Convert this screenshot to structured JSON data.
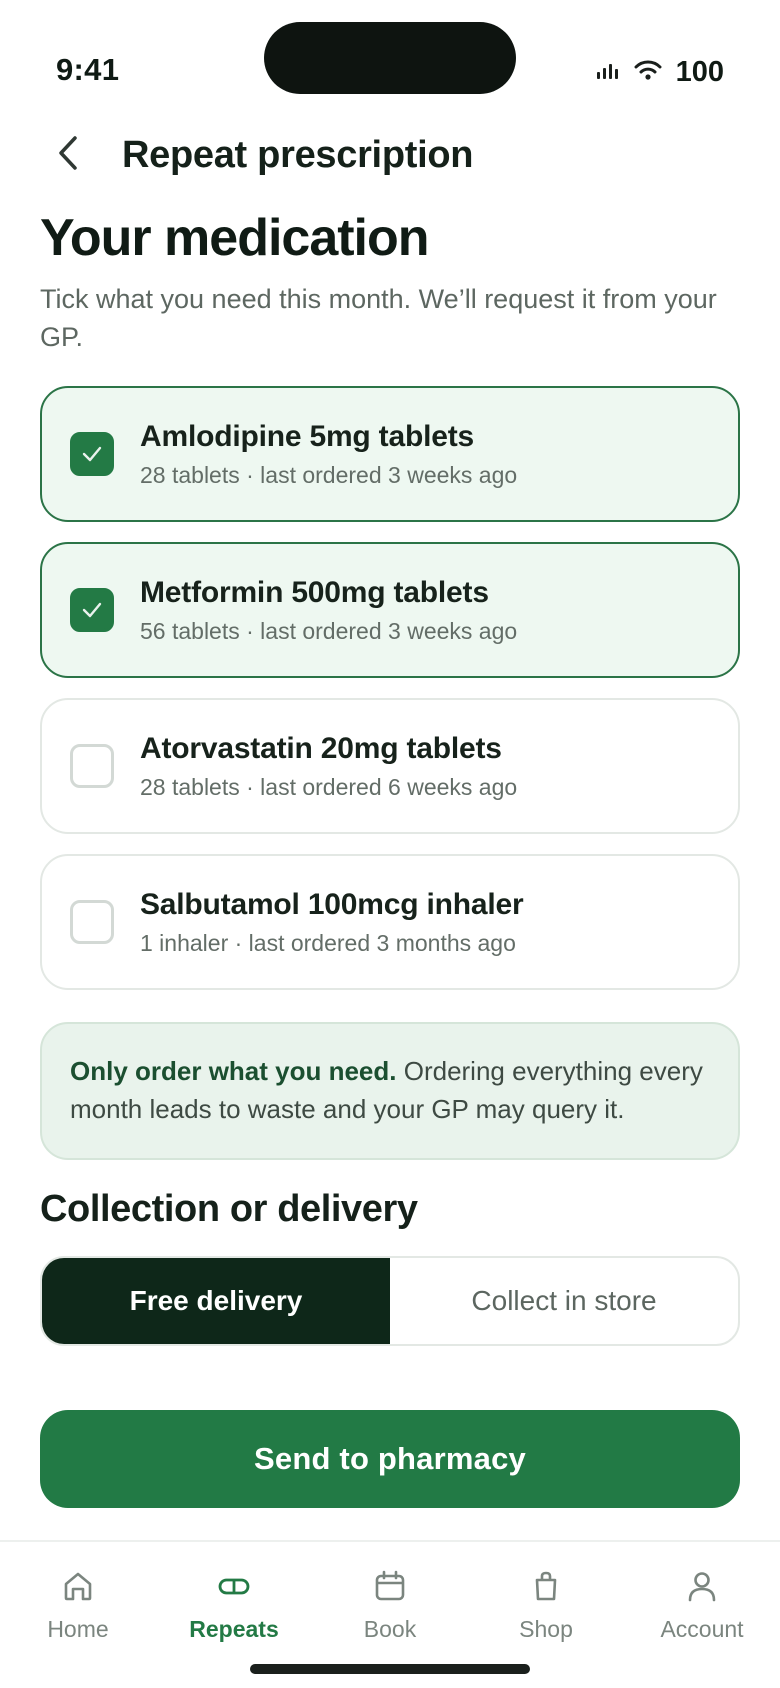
{
  "status_bar": {
    "time": "9:41",
    "battery": "100"
  },
  "header": {
    "title": "Repeat prescription"
  },
  "page": {
    "title": "Your medication",
    "subtitle": "Tick what you need this month. We’ll request it from your GP."
  },
  "medications": [
    {
      "name": "Amlodipine 5mg tablets",
      "meta": "28 tablets · last ordered 3 weeks ago",
      "checked": true
    },
    {
      "name": "Metformin 500mg tablets",
      "meta": "56 tablets · last ordered 3 weeks ago",
      "checked": true
    },
    {
      "name": "Atorvastatin 20mg tablets",
      "meta": "28 tablets · last ordered 6 weeks ago",
      "checked": false
    },
    {
      "name": "Salbutamol 100mcg inhaler",
      "meta": "1 inhaler · last ordered 3 months ago",
      "checked": false
    }
  ],
  "notice": {
    "bold": "Only order what you need.",
    "text": " Ordering everything every month leads to waste and your GP may query it."
  },
  "delivery": {
    "title": "Collection or delivery",
    "options": [
      "Free delivery",
      "Collect in store"
    ],
    "selected": "Free delivery"
  },
  "cta": {
    "label": "Send to pharmacy"
  },
  "tabs": [
    {
      "label": "Home",
      "icon": "home-icon",
      "active": false
    },
    {
      "label": "Repeats",
      "icon": "pill-icon",
      "active": true
    },
    {
      "label": "Book",
      "icon": "calendar-icon",
      "active": false
    },
    {
      "label": "Shop",
      "icon": "bag-icon",
      "active": false
    },
    {
      "label": "Account",
      "icon": "person-icon",
      "active": false
    }
  ],
  "colors": {
    "accent": "#237a45",
    "dark": "#0e2719",
    "checked_bg": "#eef8f1"
  }
}
